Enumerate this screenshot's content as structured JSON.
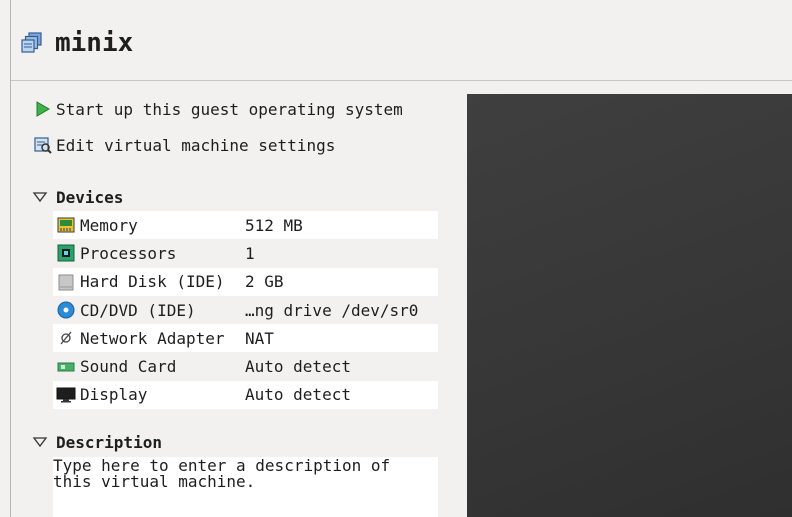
{
  "vm": {
    "name": "minix"
  },
  "actions": {
    "start_label": "Start up this guest operating system",
    "edit_label": "Edit virtual machine settings"
  },
  "devices": {
    "heading": "Devices",
    "items": [
      {
        "name": "Memory",
        "value": "512 MB",
        "icon": "memory-icon"
      },
      {
        "name": "Processors",
        "value": "1",
        "icon": "processor-icon"
      },
      {
        "name": "Hard Disk (IDE)",
        "value": "2 GB",
        "icon": "hard-disk-icon"
      },
      {
        "name": "CD/DVD (IDE)",
        "value": "…ng drive /dev/sr0",
        "icon": "cd-dvd-icon"
      },
      {
        "name": "Network Adapter",
        "value": "NAT",
        "icon": "network-icon"
      },
      {
        "name": "Sound Card",
        "value": "Auto detect",
        "icon": "sound-card-icon"
      },
      {
        "name": "Display",
        "value": "Auto detect",
        "icon": "display-icon"
      }
    ]
  },
  "description": {
    "heading": "Description",
    "placeholder": "Type here to enter a description of this virtual machine."
  },
  "colors": {
    "play_green": "#3cb44a",
    "preview_bg": "#393939",
    "accent_blue": "#2a8cd8"
  }
}
